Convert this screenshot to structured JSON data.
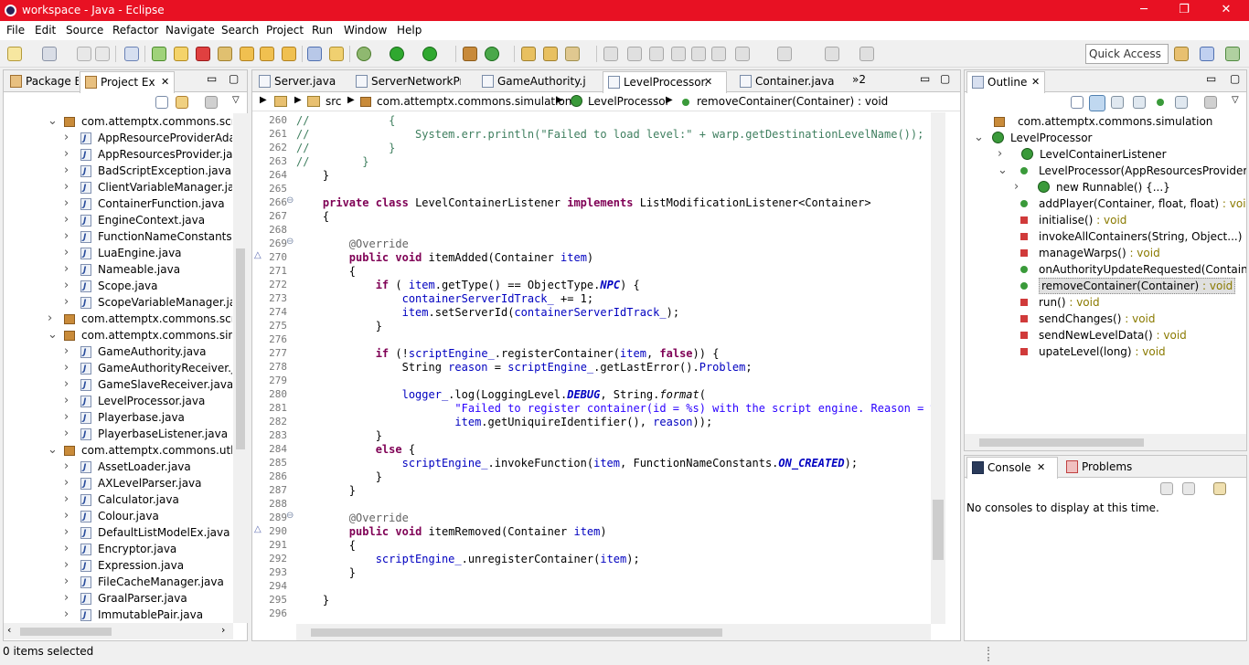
{
  "window": {
    "title": "workspace - Java - Eclipse",
    "minimize": "─",
    "restore": "❐",
    "close": "✕"
  },
  "menu": [
    "File",
    "Edit",
    "Source",
    "Refactor",
    "Navigate",
    "Search",
    "Project",
    "Run",
    "Window",
    "Help"
  ],
  "quick_access": "Quick Access",
  "left_panel": {
    "tabs": [
      "Package E",
      "Project Ex"
    ],
    "tree": [
      {
        "label": "com.attemptx.commons.scripti",
        "kind": "package",
        "expanded": true,
        "indent": 0
      },
      {
        "label": "AppResourceProviderAdapt",
        "kind": "file",
        "indent": 1
      },
      {
        "label": "AppResourcesProvider.java",
        "kind": "file",
        "indent": 1
      },
      {
        "label": "BadScriptException.java",
        "kind": "file",
        "indent": 1
      },
      {
        "label": "ClientVariableManager.java",
        "kind": "file",
        "indent": 1
      },
      {
        "label": "ContainerFunction.java",
        "kind": "file",
        "indent": 1
      },
      {
        "label": "EngineContext.java",
        "kind": "file",
        "indent": 1
      },
      {
        "label": "FunctionNameConstants.jav",
        "kind": "file",
        "indent": 1
      },
      {
        "label": "LuaEngine.java",
        "kind": "file",
        "indent": 1
      },
      {
        "label": "Nameable.java",
        "kind": "file",
        "indent": 1
      },
      {
        "label": "Scope.java",
        "kind": "file",
        "indent": 1
      },
      {
        "label": "ScopeVariableManager.java",
        "kind": "file",
        "indent": 1
      },
      {
        "label": "com.attemptx.commons.scripti",
        "kind": "package",
        "expanded": false,
        "indent": 0
      },
      {
        "label": "com.attemptx.commons.simula",
        "kind": "package",
        "expanded": true,
        "indent": 0
      },
      {
        "label": "GameAuthority.java",
        "kind": "file",
        "indent": 1
      },
      {
        "label": "GameAuthorityReceiver.java",
        "kind": "file",
        "indent": 1
      },
      {
        "label": "GameSlaveReceiver.java",
        "kind": "file",
        "indent": 1
      },
      {
        "label": "LevelProcessor.java",
        "kind": "file",
        "indent": 1
      },
      {
        "label": "Playerbase.java",
        "kind": "file",
        "indent": 1
      },
      {
        "label": "PlayerbaseListener.java",
        "kind": "file",
        "indent": 1
      },
      {
        "label": "com.attemptx.commons.utlitie",
        "kind": "package",
        "expanded": true,
        "indent": 0
      },
      {
        "label": "AssetLoader.java",
        "kind": "file",
        "indent": 1
      },
      {
        "label": "AXLevelParser.java",
        "kind": "file",
        "indent": 1
      },
      {
        "label": "Calculator.java",
        "kind": "file",
        "indent": 1
      },
      {
        "label": "Colour.java",
        "kind": "file",
        "indent": 1
      },
      {
        "label": "DefaultListModelEx.java",
        "kind": "file",
        "indent": 1
      },
      {
        "label": "Encryptor.java",
        "kind": "file",
        "indent": 1
      },
      {
        "label": "Expression.java",
        "kind": "file",
        "indent": 1
      },
      {
        "label": "FileCacheManager.java",
        "kind": "file",
        "indent": 1
      },
      {
        "label": "GraalParser.java",
        "kind": "file",
        "indent": 1
      },
      {
        "label": "ImmutablePair.java",
        "kind": "file",
        "indent": 1
      }
    ]
  },
  "editor": {
    "tabs": [
      "Server.java",
      "ServerNetworkPr",
      "GameAuthority.j",
      "LevelProcessor.",
      "Container.java"
    ],
    "more_tabs": "»2",
    "breadcrumb": [
      "src",
      "com.attemptx.commons.simulation",
      "LevelProcessor",
      "removeContainer(Container) : void"
    ],
    "lines": [
      {
        "n": "260",
        "h": "<span class='c'>//</span>            <span class='c'>{</span>"
      },
      {
        "n": "261",
        "h": "<span class='c'>//</span>                <span class='c'>System.err.println(\"Failed to load level:\" + warp.getDestinationLevelName());</span>"
      },
      {
        "n": "262",
        "h": "<span class='c'>//</span>            <span class='c'>}</span>"
      },
      {
        "n": "263",
        "h": "<span class='c'>//</span>        <span class='c'>}</span>"
      },
      {
        "n": "264",
        "h": "    }"
      },
      {
        "n": "265",
        "h": ""
      },
      {
        "n": "266",
        "h": "    <span class='k'>private</span> <span class='k'>class</span> LevelContainerListener <span class='k'>implements</span> ListModificationListener&lt;Container&gt;"
      },
      {
        "n": "267",
        "h": "    {"
      },
      {
        "n": "268",
        "h": ""
      },
      {
        "n": "269",
        "h": "        <span class='a'>@Override</span>"
      },
      {
        "n": "270",
        "h": "        <span class='k'>public</span> <span class='k'>void</span> itemAdded(Container <span class='f'>item</span>)"
      },
      {
        "n": "271",
        "h": "        {"
      },
      {
        "n": "272",
        "h": "            <span class='k'>if</span> ( <span class='f'>item</span>.getType() == ObjectType.<span class='st'>NPC</span>) {"
      },
      {
        "n": "273",
        "h": "                <span class='f'>containerServerIdTrack_</span> += 1;"
      },
      {
        "n": "274",
        "h": "                <span class='f'>item</span>.setServerId(<span class='f'>containerServerIdTrack_</span>);"
      },
      {
        "n": "275",
        "h": "            }"
      },
      {
        "n": "276",
        "h": ""
      },
      {
        "n": "277",
        "h": "            <span class='k'>if</span> (!<span class='f'>scriptEngine_</span>.registerContainer(<span class='f'>item</span>, <span class='k'>false</span>)) {"
      },
      {
        "n": "278",
        "h": "                String <span class='f'>reason</span> = <span class='f'>scriptEngine_</span>.getLastError().<span class='f'>Problem</span>;"
      },
      {
        "n": "279",
        "h": ""
      },
      {
        "n": "280",
        "h": "                <span class='f'>logger_</span>.log(LoggingLevel.<span class='st'>DEBUG</span>, String.<span class='mi'>format</span>("
      },
      {
        "n": "281",
        "h": "                        <span class='s'>\"Failed to register container(id = %s) with the script engine. Reason = %s\"</span>"
      },
      {
        "n": "282",
        "h": "                        <span class='f'>item</span>.getUniquireIdentifier(), <span class='f'>reason</span>));"
      },
      {
        "n": "283",
        "h": "            }"
      },
      {
        "n": "284",
        "h": "            <span class='k'>else</span> {"
      },
      {
        "n": "285",
        "h": "                <span class='f'>scriptEngine_</span>.invokeFunction(<span class='f'>item</span>, FunctionNameConstants.<span class='st'>ON_CREATED</span>);"
      },
      {
        "n": "286",
        "h": "            }"
      },
      {
        "n": "287",
        "h": "        }"
      },
      {
        "n": "288",
        "h": ""
      },
      {
        "n": "289",
        "h": "        <span class='a'>@Override</span>"
      },
      {
        "n": "290",
        "h": "        <span class='k'>public</span> <span class='k'>void</span> itemRemoved(Container <span class='f'>item</span>)"
      },
      {
        "n": "291",
        "h": "        {"
      },
      {
        "n": "292",
        "h": "            <span class='f'>scriptEngine_</span>.unregisterContainer(<span class='f'>item</span>);"
      },
      {
        "n": "293",
        "h": "        }"
      },
      {
        "n": "294",
        "h": ""
      },
      {
        "n": "295",
        "h": "    }"
      },
      {
        "n": "296",
        "h": ""
      }
    ]
  },
  "outline": {
    "tab": "Outline",
    "items": [
      {
        "label": "com.attemptx.commons.simulation",
        "type": "",
        "kind": "package",
        "indent": 0
      },
      {
        "label": "LevelProcessor",
        "type": "",
        "kind": "class",
        "indent": 0
      },
      {
        "label": "LevelContainerListener",
        "type": "",
        "kind": "class",
        "indent": 1
      },
      {
        "label": "LevelProcessor(AppResourcesProvider, Lev",
        "type": "",
        "kind": "public",
        "indent": 1
      },
      {
        "label": "new Runnable() {...}",
        "type": "",
        "kind": "class",
        "indent": 2
      },
      {
        "label": "addPlayer(Container, float, float)",
        "type": " : void",
        "kind": "public",
        "indent": 1
      },
      {
        "label": "initialise()",
        "type": " : void",
        "kind": "private",
        "indent": 1
      },
      {
        "label": "invokeAllContainers(String, Object...)",
        "type": " : voi",
        "kind": "private",
        "indent": 1
      },
      {
        "label": "manageWarps()",
        "type": " : void",
        "kind": "private",
        "indent": 1
      },
      {
        "label": "onAuthorityUpdateRequested(Container, i",
        "type": "",
        "kind": "public",
        "indent": 1
      },
      {
        "label": "removeContainer(Container)",
        "type": " : void",
        "kind": "public",
        "indent": 1,
        "selected": true
      },
      {
        "label": "run()",
        "type": " : void",
        "kind": "private",
        "indent": 1
      },
      {
        "label": "sendChanges()",
        "type": " : void",
        "kind": "private",
        "indent": 1
      },
      {
        "label": "sendNewLevelData()",
        "type": " : void",
        "kind": "private",
        "indent": 1
      },
      {
        "label": "upateLevel(long)",
        "type": " : void",
        "kind": "private",
        "indent": 1
      }
    ]
  },
  "console": {
    "tabs": [
      "Console",
      "Problems"
    ],
    "message": "No consoles to display at this time."
  },
  "status": {
    "selection": "0 items selected"
  },
  "colors": {
    "titlebar": "#e81123",
    "selection": "#e0e0e0",
    "keyword": "#7f0055",
    "field": "#0000c0",
    "string": "#2a00ff",
    "comment": "#3f7f5f"
  }
}
